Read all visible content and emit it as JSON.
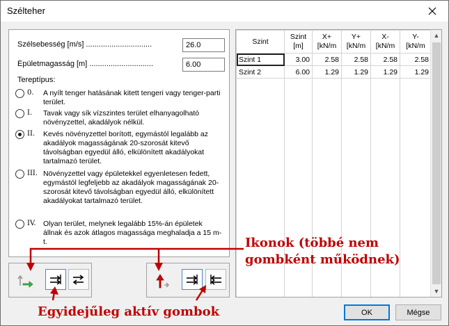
{
  "window": {
    "title": "Szélteher"
  },
  "fields": {
    "wind_speed": {
      "label": "Szélsebesség [m/s] ...............................",
      "value": "26.0"
    },
    "building_height": {
      "label": "Épületmagasság [m] ..............................",
      "value": "6.00"
    }
  },
  "terrain": {
    "label": "Tereptípus:",
    "options": [
      {
        "key": "0.",
        "text": "A nyílt tenger hatásának kitett tengeri vagy tenger-parti terület.",
        "checked": false
      },
      {
        "key": "I.",
        "text": "Tavak vagy sík vízszintes terület elhanyagolható növényzettel, akadályok nélkül.",
        "checked": false
      },
      {
        "key": "II.",
        "text": "Kevés növényzettel borított, egymástól legalább az akadályok magasságának 20-szorosát kitevő távolságban egyedül álló, elkülönített akadályokat tartalmazó terület.",
        "checked": true
      },
      {
        "key": "III.",
        "text": "Növényzettel vagy épületekkel egyenletesen fedett, egymástól legfeljebb az akadályok magasságának 20-szorosát kitevő távolságban egyedül álló, elkülönített akadályokat tartalmazó terület.",
        "checked": false
      },
      {
        "key": "IV.",
        "text": "Olyan terület, melynek legalább 15%-án épületek állnak és azok átlagos magassága meghaladja a 15 m-t.",
        "checked": false
      }
    ]
  },
  "table": {
    "headers": [
      [
        "Szint",
        ""
      ],
      [
        "Szint",
        "[m]"
      ],
      [
        "X+",
        "[kN/m"
      ],
      [
        "Y+",
        "[kN/m"
      ],
      [
        "X-",
        "[kN/m"
      ],
      [
        "Y-",
        "[kN/m"
      ]
    ],
    "rows": [
      [
        "Szint 1",
        "3.00",
        "2.58",
        "2.58",
        "2.58",
        "2.58"
      ],
      [
        "Szint 2",
        "6.00",
        "1.29",
        "1.29",
        "1.29",
        "1.29"
      ]
    ]
  },
  "buttons": {
    "ok": "OK",
    "cancel": "Mégse"
  },
  "annotations": {
    "icons": "Ikonok (többé nem",
    "icons2": "gombként működnek)",
    "active": "Egyidejűleg aktív gombok"
  },
  "colors": {
    "annotation": "#c00000",
    "active_border": "#4a86c8",
    "green_arrow": "#3cb043",
    "red_arrow": "#d40000"
  }
}
